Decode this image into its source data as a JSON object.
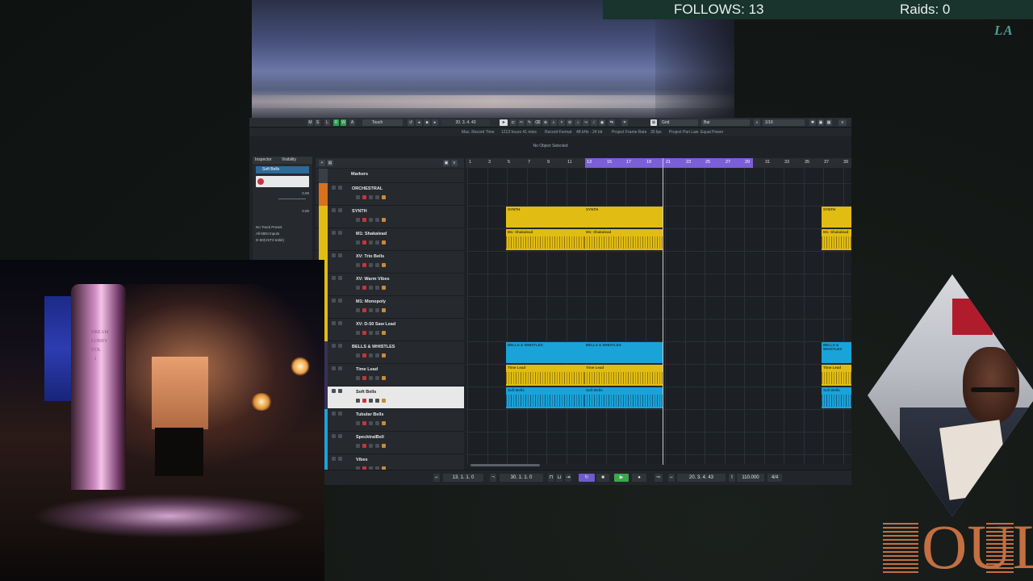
{
  "overlay": {
    "follows_label": "FOLLOWS: 13",
    "raids_label": "Raids: 0",
    "corner_text": "LA",
    "logo_text": "OUL",
    "lobby_vertical_text": "DREAM LOBBY VOL 1"
  },
  "daw": {
    "toolbar": {
      "mode": "Touch",
      "position": "20. 3. 4. 43",
      "snap": "Grid",
      "grid_type": "Bar",
      "quantize": "1/16"
    },
    "infobar": {
      "max_record_time_label": "Max. Record Time",
      "max_record_time": "1213 hours 41 mins",
      "record_format_label": "Record Format",
      "record_format": "48 kHz - 24 bit",
      "frame_rate_label": "Project Frame Rate",
      "frame_rate": "30 fps",
      "pan_law_label": "Project Pan Law",
      "pan_law": "Equal Power"
    },
    "status": "No Object Selected",
    "inspector": {
      "tab_inspector": "Inspector",
      "tab_visibility": "Visibility",
      "track_name": "Soft Bells",
      "value1": "0.00",
      "value2": "0.00",
      "preset": "No Track Preset",
      "input": "All MIDI Inputs",
      "output": "D-50(VST3 64bit)"
    },
    "ruler": [
      "1",
      "3",
      "5",
      "7",
      "9",
      "11",
      "13",
      "15",
      "17",
      "19",
      "21",
      "23",
      "25",
      "27",
      "29",
      "31",
      "33",
      "35",
      "37",
      "39"
    ],
    "tracks": [
      {
        "name": "Markers",
        "color": "#3a3f45"
      },
      {
        "name": "ORCHESTRAL",
        "color": "#d9701e"
      },
      {
        "name": "SYNTH",
        "color": "#e1bd13"
      },
      {
        "name": "M1: Shakalead",
        "color": "#e1bd13"
      },
      {
        "name": "XV: Trio Bells",
        "color": "#e1bd13"
      },
      {
        "name": "XV: Warm Vibes",
        "color": "#e1bd13"
      },
      {
        "name": "M1: Monopoly",
        "color": "#e1bd13"
      },
      {
        "name": "XV: D-50 Saw Lead",
        "color": "#e1bd13"
      },
      {
        "name": "BELLS & WHISTLES",
        "color": "#3a2f5a"
      },
      {
        "name": "Time Lead",
        "color": "#3a2f5a"
      },
      {
        "name": "Soft Bells",
        "color": "#3a2f5a"
      },
      {
        "name": "Tubular Bells",
        "color": "#1aa3d8"
      },
      {
        "name": "SpecktralBell",
        "color": "#1aa3d8"
      },
      {
        "name": "Vibes",
        "color": "#1aa3d8"
      }
    ],
    "clip_labels": {
      "synth": "SYNTH",
      "shakalead": "M1: Shakalead",
      "bells": "BELLS & WHISTLES",
      "time_lead": "Time Lead",
      "soft_bells": "Soft Bells"
    },
    "transport": {
      "left_locator": "13. 1. 1. 0",
      "right_locator": "30. 1. 1. 0",
      "position": "20. 3. 4. 43",
      "tempo": "110.000",
      "signature": "4/4"
    },
    "colors": {
      "yellow": "#e1bd13",
      "blue": "#1aa3d8",
      "cycle": "#7a5fd6",
      "play": "#3aa84a"
    }
  }
}
